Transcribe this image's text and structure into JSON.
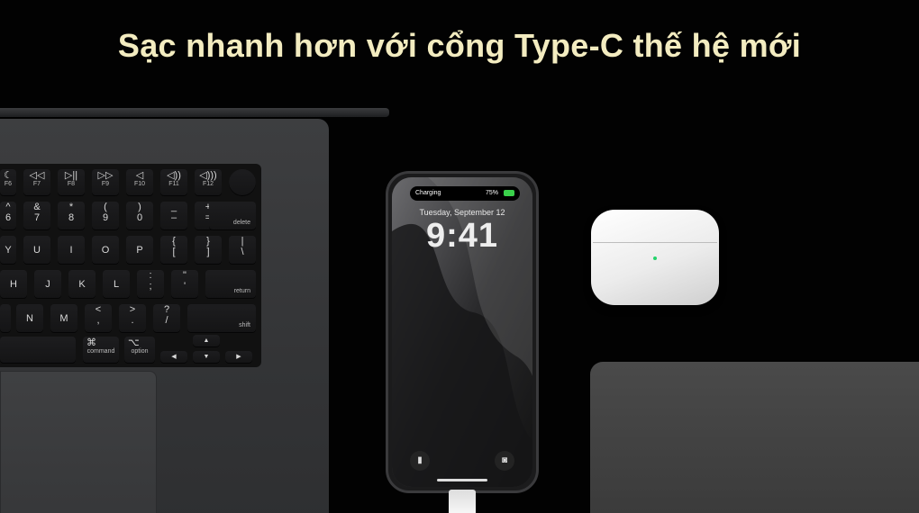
{
  "headline": "Sạc nhanh hơn với cổng Type-C thế hệ mới",
  "phone": {
    "status_label": "Charging",
    "battery_percent": "75%",
    "date": "Tuesday, September 12",
    "time": "9:41"
  },
  "keyboard": {
    "fn_row": [
      "F6",
      "F7",
      "F8",
      "F9",
      "F10",
      "F11",
      "F12"
    ],
    "fn_icons": [
      "☾",
      "◁◁",
      "▷||",
      "▷▷",
      "◁",
      "◁))",
      "◁)))"
    ],
    "num_row": [
      [
        "^",
        "6"
      ],
      [
        "&",
        "7"
      ],
      [
        "*",
        "8"
      ],
      [
        "(",
        "9"
      ],
      [
        ")",
        "0"
      ],
      [
        "_",
        "–"
      ],
      [
        "+",
        "="
      ]
    ],
    "delete_label": "delete",
    "row_q": [
      "Y",
      "U",
      "I",
      "O",
      "P"
    ],
    "row_q_sym": [
      [
        "{",
        "["
      ],
      [
        "}",
        "]"
      ],
      [
        "|",
        "\\"
      ]
    ],
    "row_a": [
      "H",
      "J",
      "K",
      "L"
    ],
    "row_a_sym": [
      [
        ":",
        ";"
      ],
      [
        "\"",
        "'"
      ]
    ],
    "return_label": "return",
    "row_z": [
      "N",
      "M"
    ],
    "row_z_sym": [
      [
        "<",
        ","
      ],
      [
        ">",
        "."
      ],
      [
        "?",
        "/"
      ]
    ],
    "shift_label": "shift",
    "command_label": "command",
    "command_symbol": "⌘",
    "option_label": "option",
    "option_symbol": "⌥"
  },
  "colors": {
    "headline": "#f3ecc0",
    "battery": "#3ad04b",
    "airpods_led": "#23d36b"
  }
}
